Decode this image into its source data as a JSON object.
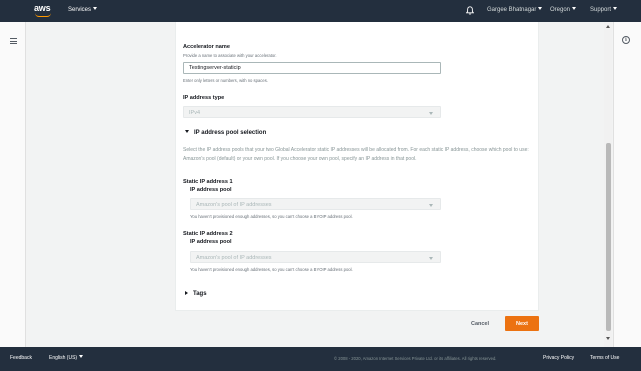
{
  "header": {
    "logo_text": "aws",
    "services_label": "Services",
    "user_label": "Gargee Bhatnagar",
    "region_label": "Oregon",
    "support_label": "Support"
  },
  "form": {
    "accelerator_name": {
      "label": "Accelerator name",
      "description": "Provide a name to associate with your accelerator.",
      "value": "Testingserver-staticip",
      "hint": "Enter only letters or numbers, with no spaces."
    },
    "ip_address_type": {
      "label": "IP address type",
      "value": "IPv4"
    },
    "pool_selection": {
      "title": "IP address pool selection",
      "description": "Select the IP address pools that your two Global Accelerator static IP addresses will be allocated from. For each static IP address, choose which pool to use: Amazon's pool (default) or your own pool. If you choose your own pool, specify an IP address in that pool.",
      "static_ip_1": {
        "heading": "Static IP address 1",
        "pool_label": "IP address pool",
        "pool_value": "Amazon's pool of IP addresses",
        "hint": "You haven't provisioned enough addresses, so you can't choose a BYOIP address pool."
      },
      "static_ip_2": {
        "heading": "Static IP address 2",
        "pool_label": "IP address pool",
        "pool_value": "Amazon's pool of IP addresses",
        "hint": "You haven't provisioned enough addresses, so you can't choose a BYOIP address pool."
      }
    },
    "tags_title": "Tags"
  },
  "actions": {
    "cancel_label": "Cancel",
    "next_label": "Next"
  },
  "footer": {
    "feedback_label": "Feedback",
    "language_label": "English (US)",
    "copyright": "© 2008 - 2020, Amazon Internet Services Private Ltd. or its affiliates. All rights reserved.",
    "privacy_label": "Privacy Policy",
    "terms_label": "Terms of Use"
  },
  "colors": {
    "nav_bg": "#232f3e",
    "accent": "#ec7211",
    "logo_accent": "#ff9900"
  }
}
